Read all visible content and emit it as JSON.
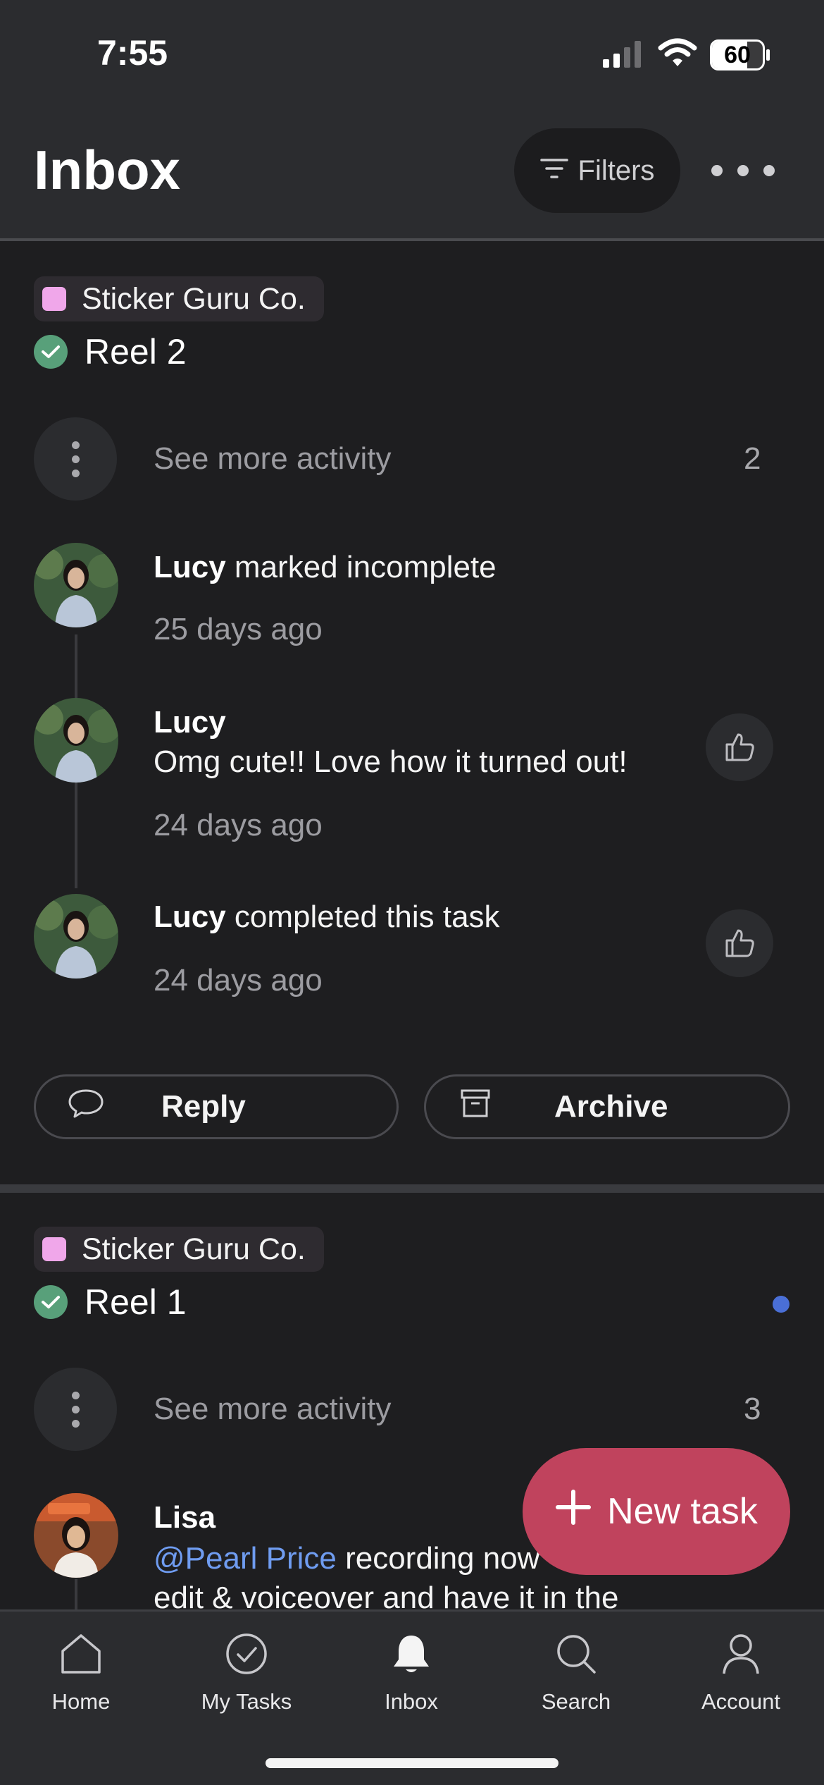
{
  "status_bar": {
    "time": "7:55",
    "battery": "60"
  },
  "header": {
    "title": "Inbox",
    "filters_label": "Filters"
  },
  "cards": [
    {
      "project": "Sticker Guru Co.",
      "task": "Reel 2",
      "see_more_label": "See more activity",
      "see_more_count": "2",
      "activities": [
        {
          "name": "Lucy",
          "action": " marked incomplete",
          "time": "25 days ago"
        },
        {
          "name": "Lucy",
          "comment": "Omg cute!! Love how it turned out!",
          "time": "24 days ago"
        },
        {
          "name": "Lucy",
          "action": " completed this task",
          "time": "24 days ago"
        }
      ],
      "reply_label": "Reply",
      "archive_label": "Archive"
    },
    {
      "project": "Sticker Guru Co.",
      "task": "Reel 1",
      "see_more_label": "See more activity",
      "see_more_count": "3",
      "activities": [
        {
          "name": "Lisa",
          "mention": "@Pearl Price",
          "comment_line1": " recording now",
          "comment_line2": "edit & voiceover and have it in the"
        }
      ]
    }
  ],
  "fab": {
    "label": "New task"
  },
  "tabs": [
    {
      "label": "Home",
      "icon": "house-icon"
    },
    {
      "label": "My Tasks",
      "icon": "check-circle-icon"
    },
    {
      "label": "Inbox",
      "icon": "bell-icon"
    },
    {
      "label": "Search",
      "icon": "magnifier-icon"
    },
    {
      "label": "Account",
      "icon": "person-icon"
    }
  ],
  "colors": {
    "background": "#1e1e20",
    "header": "#2b2c2f",
    "project_swatch": "#f0a7ea",
    "complete_green": "#58a07a",
    "fab": "#c0435d",
    "mention": "#6f9cf0",
    "unread": "#4a6fd6"
  }
}
